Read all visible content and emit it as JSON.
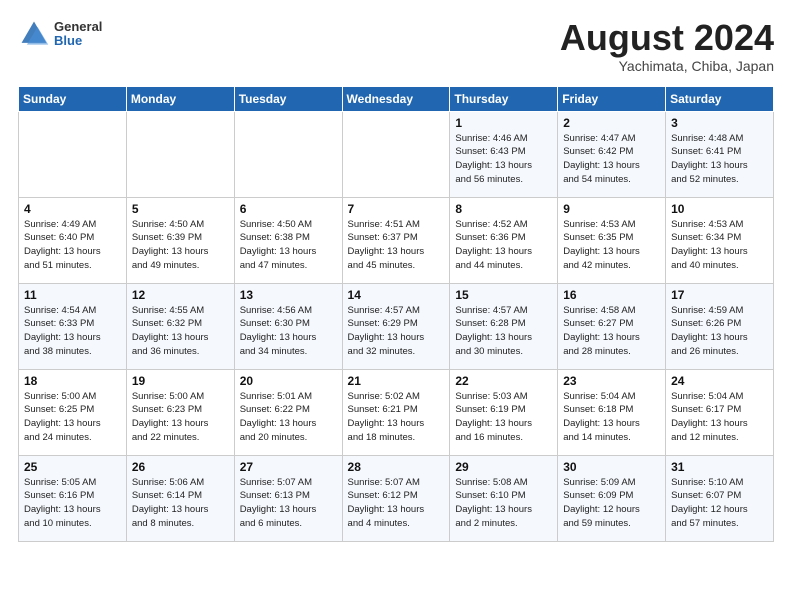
{
  "header": {
    "logo_general": "General",
    "logo_blue": "Blue",
    "month": "August 2024",
    "location": "Yachimata, Chiba, Japan"
  },
  "weekdays": [
    "Sunday",
    "Monday",
    "Tuesday",
    "Wednesday",
    "Thursday",
    "Friday",
    "Saturday"
  ],
  "weeks": [
    [
      {
        "day": "",
        "detail": ""
      },
      {
        "day": "",
        "detail": ""
      },
      {
        "day": "",
        "detail": ""
      },
      {
        "day": "",
        "detail": ""
      },
      {
        "day": "1",
        "detail": "Sunrise: 4:46 AM\nSunset: 6:43 PM\nDaylight: 13 hours\nand 56 minutes."
      },
      {
        "day": "2",
        "detail": "Sunrise: 4:47 AM\nSunset: 6:42 PM\nDaylight: 13 hours\nand 54 minutes."
      },
      {
        "day": "3",
        "detail": "Sunrise: 4:48 AM\nSunset: 6:41 PM\nDaylight: 13 hours\nand 52 minutes."
      }
    ],
    [
      {
        "day": "4",
        "detail": "Sunrise: 4:49 AM\nSunset: 6:40 PM\nDaylight: 13 hours\nand 51 minutes."
      },
      {
        "day": "5",
        "detail": "Sunrise: 4:50 AM\nSunset: 6:39 PM\nDaylight: 13 hours\nand 49 minutes."
      },
      {
        "day": "6",
        "detail": "Sunrise: 4:50 AM\nSunset: 6:38 PM\nDaylight: 13 hours\nand 47 minutes."
      },
      {
        "day": "7",
        "detail": "Sunrise: 4:51 AM\nSunset: 6:37 PM\nDaylight: 13 hours\nand 45 minutes."
      },
      {
        "day": "8",
        "detail": "Sunrise: 4:52 AM\nSunset: 6:36 PM\nDaylight: 13 hours\nand 44 minutes."
      },
      {
        "day": "9",
        "detail": "Sunrise: 4:53 AM\nSunset: 6:35 PM\nDaylight: 13 hours\nand 42 minutes."
      },
      {
        "day": "10",
        "detail": "Sunrise: 4:53 AM\nSunset: 6:34 PM\nDaylight: 13 hours\nand 40 minutes."
      }
    ],
    [
      {
        "day": "11",
        "detail": "Sunrise: 4:54 AM\nSunset: 6:33 PM\nDaylight: 13 hours\nand 38 minutes."
      },
      {
        "day": "12",
        "detail": "Sunrise: 4:55 AM\nSunset: 6:32 PM\nDaylight: 13 hours\nand 36 minutes."
      },
      {
        "day": "13",
        "detail": "Sunrise: 4:56 AM\nSunset: 6:30 PM\nDaylight: 13 hours\nand 34 minutes."
      },
      {
        "day": "14",
        "detail": "Sunrise: 4:57 AM\nSunset: 6:29 PM\nDaylight: 13 hours\nand 32 minutes."
      },
      {
        "day": "15",
        "detail": "Sunrise: 4:57 AM\nSunset: 6:28 PM\nDaylight: 13 hours\nand 30 minutes."
      },
      {
        "day": "16",
        "detail": "Sunrise: 4:58 AM\nSunset: 6:27 PM\nDaylight: 13 hours\nand 28 minutes."
      },
      {
        "day": "17",
        "detail": "Sunrise: 4:59 AM\nSunset: 6:26 PM\nDaylight: 13 hours\nand 26 minutes."
      }
    ],
    [
      {
        "day": "18",
        "detail": "Sunrise: 5:00 AM\nSunset: 6:25 PM\nDaylight: 13 hours\nand 24 minutes."
      },
      {
        "day": "19",
        "detail": "Sunrise: 5:00 AM\nSunset: 6:23 PM\nDaylight: 13 hours\nand 22 minutes."
      },
      {
        "day": "20",
        "detail": "Sunrise: 5:01 AM\nSunset: 6:22 PM\nDaylight: 13 hours\nand 20 minutes."
      },
      {
        "day": "21",
        "detail": "Sunrise: 5:02 AM\nSunset: 6:21 PM\nDaylight: 13 hours\nand 18 minutes."
      },
      {
        "day": "22",
        "detail": "Sunrise: 5:03 AM\nSunset: 6:19 PM\nDaylight: 13 hours\nand 16 minutes."
      },
      {
        "day": "23",
        "detail": "Sunrise: 5:04 AM\nSunset: 6:18 PM\nDaylight: 13 hours\nand 14 minutes."
      },
      {
        "day": "24",
        "detail": "Sunrise: 5:04 AM\nSunset: 6:17 PM\nDaylight: 13 hours\nand 12 minutes."
      }
    ],
    [
      {
        "day": "25",
        "detail": "Sunrise: 5:05 AM\nSunset: 6:16 PM\nDaylight: 13 hours\nand 10 minutes."
      },
      {
        "day": "26",
        "detail": "Sunrise: 5:06 AM\nSunset: 6:14 PM\nDaylight: 13 hours\nand 8 minutes."
      },
      {
        "day": "27",
        "detail": "Sunrise: 5:07 AM\nSunset: 6:13 PM\nDaylight: 13 hours\nand 6 minutes."
      },
      {
        "day": "28",
        "detail": "Sunrise: 5:07 AM\nSunset: 6:12 PM\nDaylight: 13 hours\nand 4 minutes."
      },
      {
        "day": "29",
        "detail": "Sunrise: 5:08 AM\nSunset: 6:10 PM\nDaylight: 13 hours\nand 2 minutes."
      },
      {
        "day": "30",
        "detail": "Sunrise: 5:09 AM\nSunset: 6:09 PM\nDaylight: 12 hours\nand 59 minutes."
      },
      {
        "day": "31",
        "detail": "Sunrise: 5:10 AM\nSunset: 6:07 PM\nDaylight: 12 hours\nand 57 minutes."
      }
    ]
  ]
}
